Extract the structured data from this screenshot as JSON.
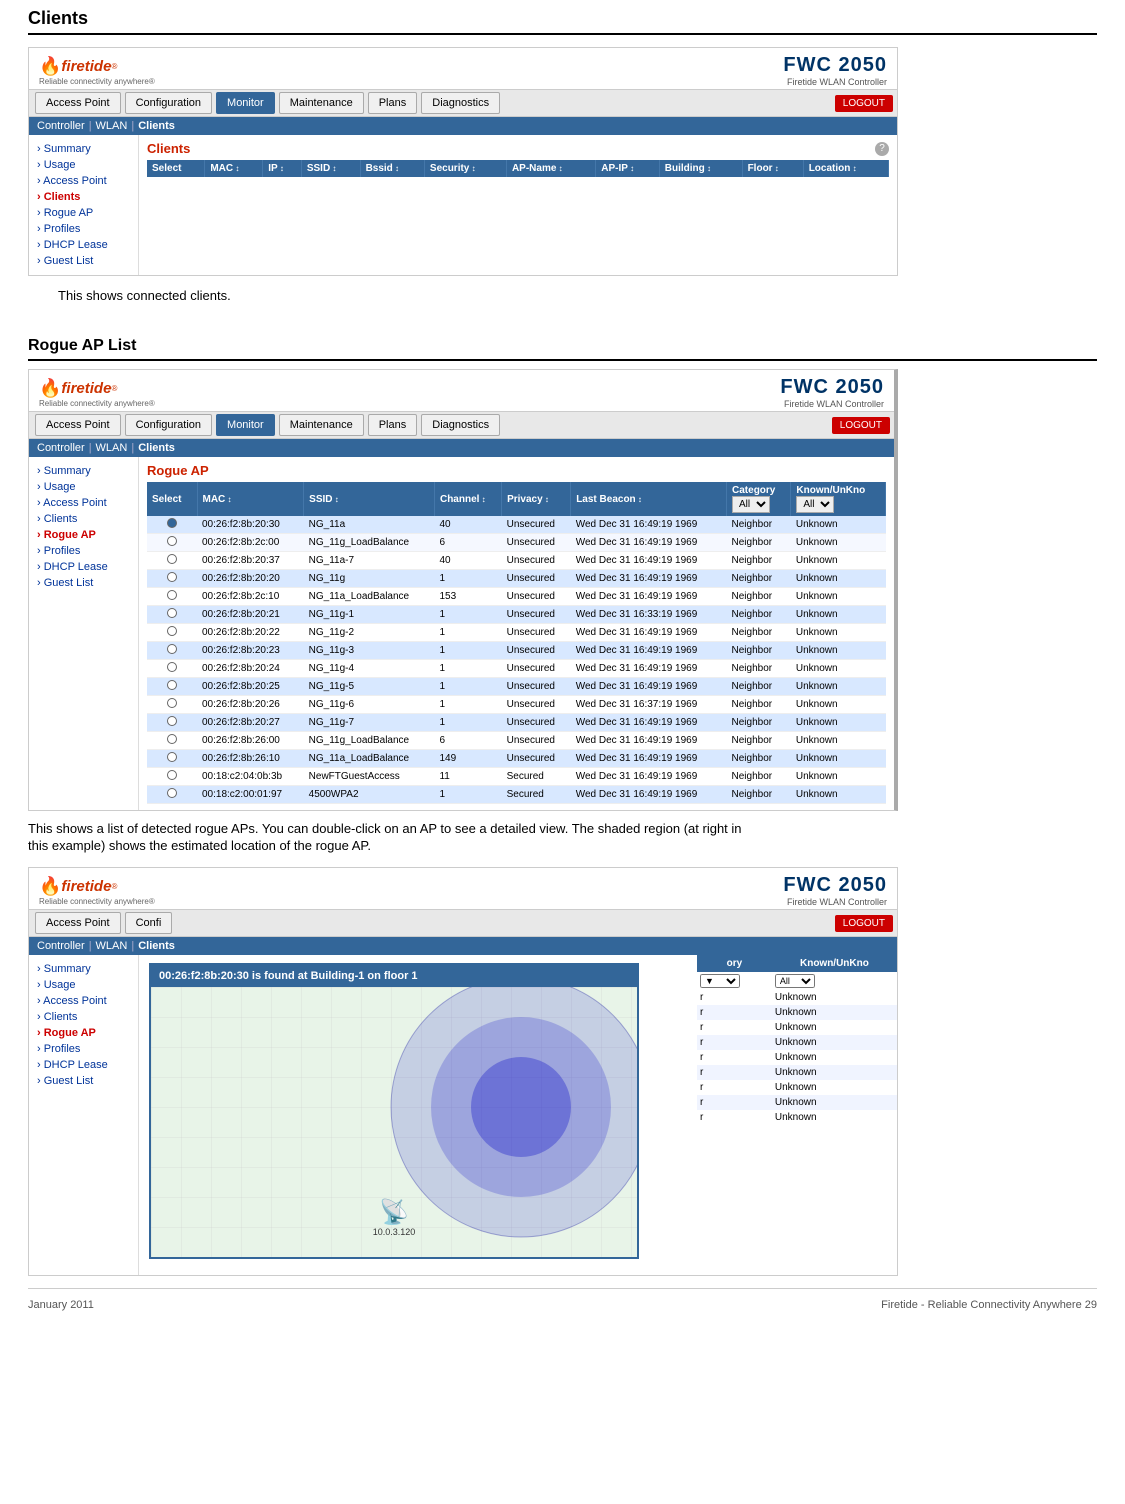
{
  "page": {
    "title": "Clients",
    "section2": "Rogue AP List",
    "footer_left": "January 2011",
    "footer_right": "Firetide - Reliable Connectivity Anywhere 29"
  },
  "brand": {
    "logo_name": "firetide",
    "logo_tagline": "Reliable connectivity anywhere®",
    "product": "FWC 2050",
    "product_sub": "Firetide WLAN Controller",
    "logout": "LOGOUT"
  },
  "nav": {
    "items": [
      {
        "label": "Access Point",
        "active": false
      },
      {
        "label": "Configuration",
        "active": false
      },
      {
        "label": "Monitor",
        "active": true
      },
      {
        "label": "Maintenance",
        "active": false
      },
      {
        "label": "Plans",
        "active": false
      },
      {
        "label": "Diagnostics",
        "active": false
      }
    ]
  },
  "breadcrumb": {
    "items": [
      "Controller",
      "WLAN",
      "Clients"
    ]
  },
  "sidebar1": {
    "items": [
      {
        "label": "Summary",
        "active": false
      },
      {
        "label": "Usage",
        "active": false
      },
      {
        "label": "Access Point",
        "active": false
      },
      {
        "label": "Clients",
        "active": true
      },
      {
        "label": "Rogue AP",
        "active": false
      },
      {
        "label": "Profiles",
        "active": false
      },
      {
        "label": "DHCP Lease",
        "active": false
      },
      {
        "label": "Guest List",
        "active": false
      }
    ]
  },
  "clients_panel": {
    "title": "Clients",
    "columns": [
      "Select",
      "MAC ↕",
      "IP ↕",
      "SSID ↕",
      "Bssid ↕",
      "Security ↕",
      "AP-Name ↕",
      "AP-IP ↕",
      "Building ↕",
      "Floor ↕",
      "Location ↕"
    ],
    "rows": []
  },
  "clients_desc": "This shows connected clients.",
  "rogue_panel": {
    "title": "Rogue AP",
    "columns": [
      "Select",
      "MAC ↕",
      "SSID ↕",
      "Channel ↕",
      "Privacy ↕",
      "Last Beacon ↕",
      "Category",
      "Known/UnKno"
    ],
    "category_options": [
      "All"
    ],
    "known_options": [
      "All"
    ],
    "rows": [
      {
        "mac": "00:26:f2:8b:20:30",
        "ssid": "NG_11a",
        "channel": "40",
        "privacy": "Unsecured",
        "beacon": "Wed Dec 31 16:49:19 1969",
        "category": "Neighbor",
        "known": "Unknown",
        "hl": true,
        "selected": true
      },
      {
        "mac": "00:26:f2:8b:2c:00",
        "ssid": "NG_11g_LoadBalance",
        "channel": "6",
        "privacy": "Unsecured",
        "beacon": "Wed Dec 31 16:49:19 1969",
        "category": "Neighbor",
        "known": "Unknown",
        "hl": false,
        "selected": false
      },
      {
        "mac": "00:26:f2:8b:20:37",
        "ssid": "NG_11a-7",
        "channel": "40",
        "privacy": "Unsecured",
        "beacon": "Wed Dec 31 16:49:19 1969",
        "category": "Neighbor",
        "known": "Unknown",
        "hl": false,
        "selected": false
      },
      {
        "mac": "00:26:f2:8b:20:20",
        "ssid": "NG_11g",
        "channel": "1",
        "privacy": "Unsecured",
        "beacon": "Wed Dec 31 16:49:19 1969",
        "category": "Neighbor",
        "known": "Unknown",
        "hl": true,
        "selected": false
      },
      {
        "mac": "00:26:f2:8b:2c:10",
        "ssid": "NG_11a_LoadBalance",
        "channel": "153",
        "privacy": "Unsecured",
        "beacon": "Wed Dec 31 16:49:19 1969",
        "category": "Neighbor",
        "known": "Unknown",
        "hl": false,
        "selected": false
      },
      {
        "mac": "00:26:f2:8b:20:21",
        "ssid": "NG_11g-1",
        "channel": "1",
        "privacy": "Unsecured",
        "beacon": "Wed Dec 31 16:33:19 1969",
        "category": "Neighbor",
        "known": "Unknown",
        "hl": true,
        "selected": false
      },
      {
        "mac": "00:26:f2:8b:20:22",
        "ssid": "NG_11g-2",
        "channel": "1",
        "privacy": "Unsecured",
        "beacon": "Wed Dec 31 16:49:19 1969",
        "category": "Neighbor",
        "known": "Unknown",
        "hl": false,
        "selected": false
      },
      {
        "mac": "00:26:f2:8b:20:23",
        "ssid": "NG_11g-3",
        "channel": "1",
        "privacy": "Unsecured",
        "beacon": "Wed Dec 31 16:49:19 1969",
        "category": "Neighbor",
        "known": "Unknown",
        "hl": true,
        "selected": false
      },
      {
        "mac": "00:26:f2:8b:20:24",
        "ssid": "NG_11g-4",
        "channel": "1",
        "privacy": "Unsecured",
        "beacon": "Wed Dec 31 16:49:19 1969",
        "category": "Neighbor",
        "known": "Unknown",
        "hl": false,
        "selected": false
      },
      {
        "mac": "00:26:f2:8b:20:25",
        "ssid": "NG_11g-5",
        "channel": "1",
        "privacy": "Unsecured",
        "beacon": "Wed Dec 31 16:49:19 1969",
        "category": "Neighbor",
        "known": "Unknown",
        "hl": true,
        "selected": false
      },
      {
        "mac": "00:26:f2:8b:20:26",
        "ssid": "NG_11g-6",
        "channel": "1",
        "privacy": "Unsecured",
        "beacon": "Wed Dec 31 16:37:19 1969",
        "category": "Neighbor",
        "known": "Unknown",
        "hl": false,
        "selected": false
      },
      {
        "mac": "00:26:f2:8b:20:27",
        "ssid": "NG_11g-7",
        "channel": "1",
        "privacy": "Unsecured",
        "beacon": "Wed Dec 31 16:49:19 1969",
        "category": "Neighbor",
        "known": "Unknown",
        "hl": true,
        "selected": false
      },
      {
        "mac": "00:26:f2:8b:26:00",
        "ssid": "NG_11g_LoadBalance",
        "channel": "6",
        "privacy": "Unsecured",
        "beacon": "Wed Dec 31 16:49:19 1969",
        "category": "Neighbor",
        "known": "Unknown",
        "hl": false,
        "selected": false
      },
      {
        "mac": "00:26:f2:8b:26:10",
        "ssid": "NG_11a_LoadBalance",
        "channel": "149",
        "privacy": "Unsecured",
        "beacon": "Wed Dec 31 16:49:19 1969",
        "category": "Neighbor",
        "known": "Unknown",
        "hl": true,
        "selected": false
      },
      {
        "mac": "00:18:c2:04:0b:3b",
        "ssid": "NewFTGuestAccess",
        "channel": "11",
        "privacy": "Secured",
        "beacon": "Wed Dec 31 16:49:19 1969",
        "category": "Neighbor",
        "known": "Unknown",
        "hl": false,
        "selected": false
      },
      {
        "mac": "00:18:c2:00:01:97",
        "ssid": "4500WPA2",
        "channel": "1",
        "privacy": "Secured",
        "beacon": "Wed Dec 31 16:49:19 1969",
        "category": "Neighbor",
        "known": "Unknown",
        "hl": true,
        "selected": false
      }
    ]
  },
  "rogue_desc1": "This shows a list of detected rogue APs. You can double-click on an AP to see a detailed view. The shaded region (at right in",
  "rogue_desc2": "this example) shows the estimated location of the rogue AP.",
  "popup": {
    "title": "00:26:f2:8b:20:30 is found at Building-1 on floor 1",
    "ap_label": "10.0.3.120"
  },
  "sidebar2": {
    "items": [
      {
        "label": "Summary",
        "active": false
      },
      {
        "label": "Usage",
        "active": false
      },
      {
        "label": "Access Point",
        "active": false
      },
      {
        "label": "Clients",
        "active": false
      },
      {
        "label": "Rogue AP",
        "active": true
      },
      {
        "label": "Profiles",
        "active": false
      },
      {
        "label": "DHCP Lease",
        "active": false
      },
      {
        "label": "Guest List",
        "active": false
      }
    ]
  }
}
